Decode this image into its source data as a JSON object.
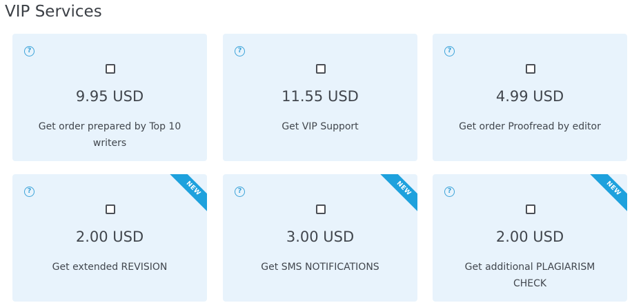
{
  "section_title": "VIP Services",
  "help_glyph": "?",
  "cards": [
    {
      "price": "9.95 USD",
      "description": "Get order prepared by Top 10 writers",
      "badge": ""
    },
    {
      "price": "11.55 USD",
      "description": "Get VIP Support",
      "badge": ""
    },
    {
      "price": "4.99 USD",
      "description": "Get order Proofread by editor",
      "badge": ""
    },
    {
      "price": "2.00 USD",
      "description": "Get extended REVISION",
      "badge": "NEW"
    },
    {
      "price": "3.00 USD",
      "description": "Get SMS NOTIFICATIONS",
      "badge": "NEW"
    },
    {
      "price": "2.00 USD",
      "description": "Get additional PLAGIARISM CHECK",
      "badge": "NEW"
    }
  ],
  "colors": {
    "card_background": "#e8f3fc",
    "accent": "#1ea1dd",
    "text": "#41464d"
  }
}
